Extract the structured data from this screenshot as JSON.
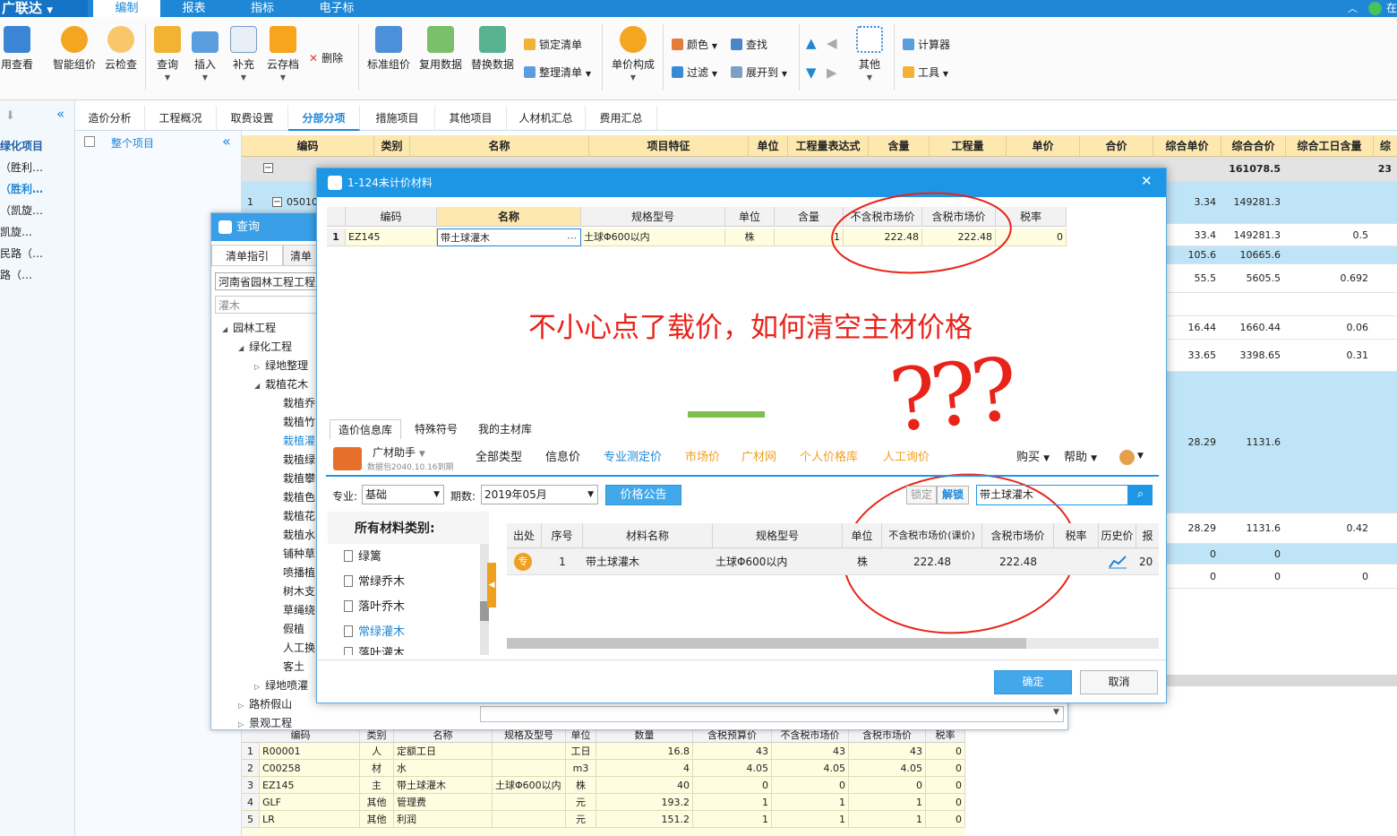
{
  "app": {
    "logo": "广联达",
    "menu": [
      "编制",
      "报表",
      "指标",
      "电子标"
    ],
    "active_menu": "编制",
    "top_right": "在"
  },
  "ribbon": {
    "big_buttons": [
      "用查看",
      "智能组价",
      "云检查",
      "查询",
      "插入",
      "补充",
      "云存档",
      "标准组价",
      "复用数据",
      "替换数据",
      "单价构成",
      "其他"
    ],
    "small_buttons": [
      "删除",
      "锁定清单",
      "整理清单",
      "颜色",
      "查找",
      "过滤",
      "展开到",
      "计算器",
      "工具"
    ]
  },
  "left_panel": {
    "items": [
      "绿化项目",
      "（胜利…",
      "（胜利…",
      "（凯旋…",
      "凯旋…",
      "民路（…",
      "路（…"
    ]
  },
  "tree_panel": {
    "item": "整个项目"
  },
  "tabs": [
    "造价分析",
    "工程概况",
    "取费设置",
    "分部分项",
    "措施项目",
    "其他项目",
    "人材机汇总",
    "费用汇总"
  ],
  "active_tab": "分部分项",
  "main_grid": {
    "headers": [
      "编码",
      "类别",
      "名称",
      "项目特征",
      "单位",
      "工程量表达式",
      "含量",
      "工程量",
      "单价",
      "合价",
      "综合单价",
      "综合合价",
      "综合工日含量",
      "综"
    ],
    "summary_row": {
      "name": "整个项目",
      "total": "161078.5",
      "last": "23"
    },
    "row1": {
      "num": "1",
      "code": "05010",
      "unit_price": "3.34",
      "total": "149281.3"
    },
    "rows": [
      {
        "unit_price": "33.4",
        "total": "149281.3",
        "labor": "0.5"
      },
      {
        "unit_price": "105.6",
        "total": "10665.6",
        "labor": ""
      },
      {
        "unit_price": "55.5",
        "total": "5605.5",
        "labor": "0.692"
      },
      {
        "unit_price": "16.44",
        "total": "1660.44",
        "labor": "0.06"
      },
      {
        "unit_price": "33.65",
        "total": "3398.65",
        "labor": "0.31"
      },
      {
        "unit_price": "28.29",
        "total": "1131.6",
        "labor": ""
      },
      {
        "unit_price": "28.29",
        "total": "1131.6",
        "labor": "0.42"
      },
      {
        "unit_price": "0",
        "total": "0",
        "labor": ""
      },
      {
        "unit_price": "0",
        "total": "0",
        "labor": "0"
      }
    ]
  },
  "bottom_grid": {
    "headers": [
      "编码",
      "类别",
      "名称",
      "规格及型号",
      "单位",
      "数量",
      "含税预算价",
      "不含税市场价",
      "含税市场价",
      "税率"
    ],
    "rows": [
      [
        "1",
        "R00001",
        "人",
        "定额工日",
        "",
        "工日",
        "16.8",
        "43",
        "43",
        "43",
        "0"
      ],
      [
        "2",
        "C00258",
        "材",
        "水",
        "",
        "m3",
        "4",
        "4.05",
        "4.05",
        "4.05",
        "0"
      ],
      [
        "3",
        "EZ145",
        "主",
        "带土球灌木",
        "土球Φ600以内",
        "株",
        "40",
        "0",
        "0",
        "0",
        "0"
      ],
      [
        "4",
        "GLF",
        "其他",
        "管理费",
        "",
        "元",
        "193.2",
        "1",
        "1",
        "1",
        "0"
      ],
      [
        "5",
        "LR",
        "其他",
        "利润",
        "",
        "元",
        "151.2",
        "1",
        "1",
        "1",
        "0"
      ]
    ]
  },
  "query_dialog": {
    "title": "查询",
    "tabs": [
      "清单指引",
      "清单"
    ],
    "library": "河南省园林工程工程量",
    "search_value": "灌木",
    "tree": [
      "园林工程",
      "绿化工程",
      "绿地整理",
      "栽植花木",
      "栽植乔",
      "栽植竹",
      "栽植灌",
      "栽植绿",
      "栽植攀",
      "栽植色",
      "栽植花",
      "栽植水",
      "铺种草",
      "喷播植",
      "树木支",
      "草绳绕",
      "假植",
      "人工换",
      "客土",
      "绿地喷灌",
      "路桥假山",
      "景观工程"
    ]
  },
  "material_dialog": {
    "title": "1-124未计价材料",
    "headers": [
      "编码",
      "名称",
      "规格型号",
      "单位",
      "含量",
      "不含税市场价",
      "含税市场价",
      "税率"
    ],
    "row": {
      "num": "1",
      "code": "EZ145",
      "name": "带土球灌木",
      "spec": "土球Φ600以内",
      "unit": "株",
      "qty": "1",
      "price_ex": "222.48",
      "price_inc": "222.48",
      "tax": "0"
    },
    "annotation": "不小心点了载价，如何清空主材价格",
    "marks": "???",
    "lib_tabs": [
      "造价信息库",
      "特殊符号",
      "我的主材库"
    ],
    "assistant": {
      "name": "广材助手",
      "sub": "数据包2040.10.16到期"
    },
    "price_links": [
      "全部类型",
      "信息价",
      "专业测定价",
      "市场价",
      "广材网",
      "个人价格库",
      "人工询价"
    ],
    "active_price_link": "专业测定价",
    "right_links": [
      "购买",
      "帮助"
    ],
    "filter": {
      "major_label": "专业:",
      "major": "基础",
      "period_label": "期数:",
      "period": "2019年05月",
      "notice_button": "价格公告",
      "lock": "锁定",
      "unlock": "解锁",
      "search": "带土球灌木"
    },
    "category_title": "所有材料类别:",
    "categories": [
      "绿篱",
      "常绿乔木",
      "落叶乔木",
      "常绿灌木",
      "落叶灌木"
    ],
    "active_category": "常绿灌木",
    "result_headers": [
      "出处",
      "序号",
      "材料名称",
      "规格型号",
      "单位",
      "不含税市场价(课价)",
      "含税市场价",
      "税率",
      "历史价",
      "报"
    ],
    "result_row": {
      "source": "专",
      "num": "1",
      "name": "带土球灌木",
      "spec": "土球Φ600以内",
      "unit": "株",
      "price_ex": "222.48",
      "price_inc": "222.48",
      "tax": "",
      "extra": "20"
    },
    "ok": "确定",
    "cancel": "取消"
  },
  "colors": {
    "accent": "#1e87d6",
    "header_bg": "#fde8b0",
    "row_blue": "#bfe4f7",
    "annotation": "#e8231a",
    "orange": "#f0a020"
  }
}
